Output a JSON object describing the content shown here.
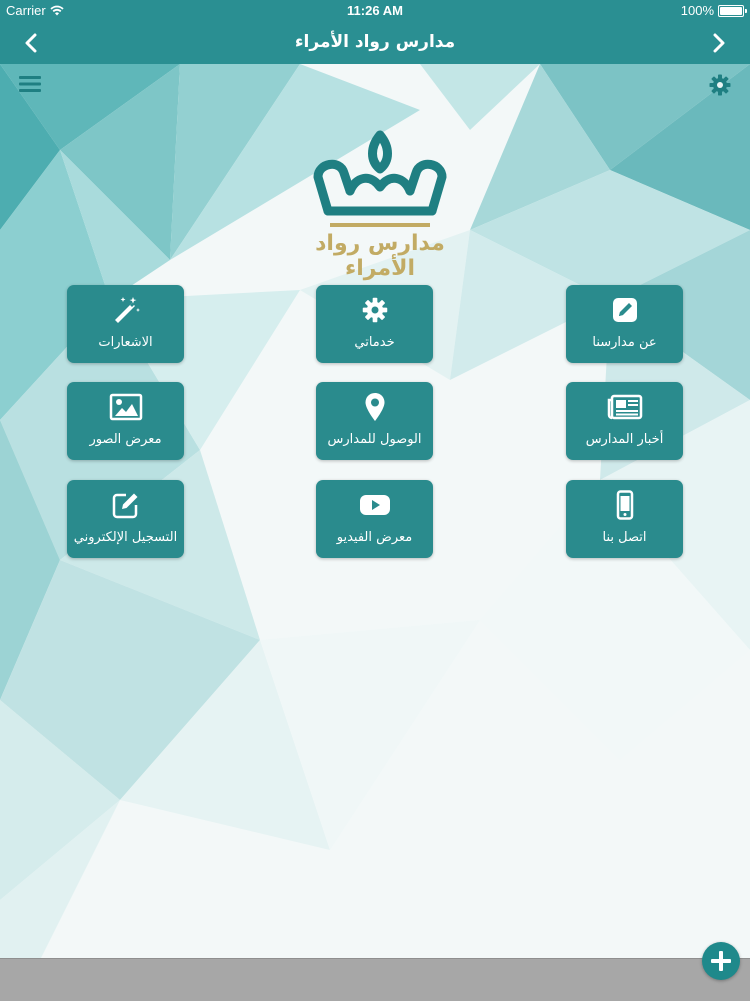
{
  "status_bar": {
    "carrier": "Carrier",
    "time": "11:26 AM",
    "battery": "100%"
  },
  "nav": {
    "title": "مدارس رواد الأمراء"
  },
  "logo": {
    "text": "مدارس رواد الأمراء"
  },
  "tiles": [
    {
      "label": "عن مدارسنا",
      "icon": "edit-square-icon"
    },
    {
      "label": "خدماتي",
      "icon": "gear-icon"
    },
    {
      "label": "الاشعارات",
      "icon": "magic-wand-icon"
    },
    {
      "label": "أخبار المدارس",
      "icon": "newspaper-icon"
    },
    {
      "label": "الوصول للمدارس",
      "icon": "map-marker-icon"
    },
    {
      "label": "معرض الصور",
      "icon": "image-icon"
    },
    {
      "label": "اتصل بنا",
      "icon": "mobile-phone-icon"
    },
    {
      "label": "معرض الفيديو",
      "icon": "youtube-play-icon"
    },
    {
      "label": "التسجيل الإلكتروني",
      "icon": "pencil-square-icon"
    }
  ],
  "colors": {
    "primary": "#2a8f92",
    "tile": "#2a8b8d",
    "logo_gold": "#c2ab64",
    "bottom_bar": "#a7a7a7"
  }
}
